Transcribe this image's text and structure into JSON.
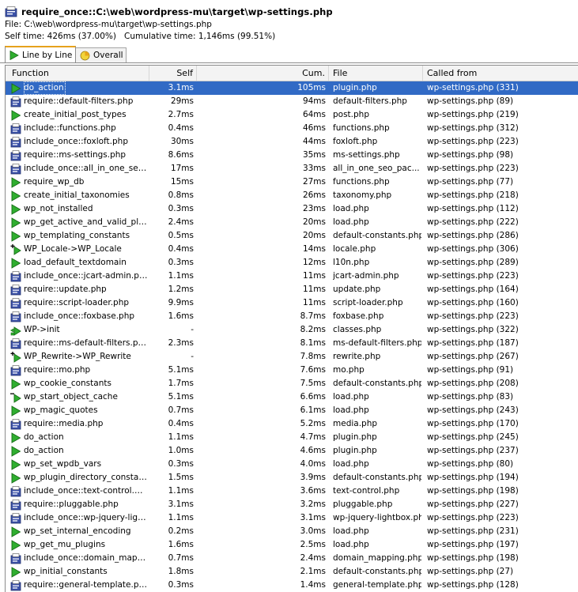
{
  "header": {
    "title": "require_once::C:\\web\\wordpress-mu\\target\\wp-settings.php",
    "file_line": "File: C:\\web\\wordpress-mu\\target\\wp-settings.php",
    "self_time": "Self time: 426ms (37.00%)",
    "cumulative_time": "Cumulative time: 1,146ms (99.51%)"
  },
  "tabs": [
    {
      "label": "Line by Line",
      "icon": "play-icon",
      "active": true
    },
    {
      "label": "Overall",
      "icon": "pie-chart-icon",
      "active": false
    }
  ],
  "columns": {
    "function": "Function",
    "self": "Self",
    "cum": "Cum.",
    "file": "File",
    "called_from": "Called from"
  },
  "rows": [
    {
      "icon": "play",
      "function": "do_action",
      "self": "3.1ms",
      "cum": "105ms",
      "file": "plugin.php",
      "called_from": "wp-settings.php (331)",
      "selected": true
    },
    {
      "icon": "php",
      "function": "require::default-filters.php",
      "self": "29ms",
      "cum": "94ms",
      "file": "default-filters.php",
      "called_from": "wp-settings.php (89)"
    },
    {
      "icon": "play",
      "function": "create_initial_post_types",
      "self": "2.7ms",
      "cum": "64ms",
      "file": "post.php",
      "called_from": "wp-settings.php (219)"
    },
    {
      "icon": "php",
      "function": "include::functions.php",
      "self": "0.4ms",
      "cum": "46ms",
      "file": "functions.php",
      "called_from": "wp-settings.php (312)"
    },
    {
      "icon": "php",
      "function": "include_once::foxloft.php",
      "self": "30ms",
      "cum": "44ms",
      "file": "foxloft.php",
      "called_from": "wp-settings.php (223)"
    },
    {
      "icon": "php",
      "function": "require::ms-settings.php",
      "self": "8.6ms",
      "cum": "35ms",
      "file": "ms-settings.php",
      "called_from": "wp-settings.php (98)"
    },
    {
      "icon": "php",
      "function": "include_once::all_in_one_seo_...",
      "self": "17ms",
      "cum": "33ms",
      "file": "all_in_one_seo_pac...",
      "called_from": "wp-settings.php (223)"
    },
    {
      "icon": "play",
      "function": "require_wp_db",
      "self": "15ms",
      "cum": "27ms",
      "file": "functions.php",
      "called_from": "wp-settings.php (77)"
    },
    {
      "icon": "play",
      "function": "create_initial_taxonomies",
      "self": "0.8ms",
      "cum": "26ms",
      "file": "taxonomy.php",
      "called_from": "wp-settings.php (218)"
    },
    {
      "icon": "play",
      "function": "wp_not_installed",
      "self": "0.3ms",
      "cum": "23ms",
      "file": "load.php",
      "called_from": "wp-settings.php (112)"
    },
    {
      "icon": "play",
      "function": "wp_get_active_and_valid_plu...",
      "self": "2.4ms",
      "cum": "20ms",
      "file": "load.php",
      "called_from": "wp-settings.php (222)"
    },
    {
      "icon": "play",
      "function": "wp_templating_constants",
      "self": "0.5ms",
      "cum": "20ms",
      "file": "default-constants.php",
      "called_from": "wp-settings.php (286)"
    },
    {
      "icon": "new",
      "function": "WP_Locale->WP_Locale",
      "self": "0.4ms",
      "cum": "14ms",
      "file": "locale.php",
      "called_from": "wp-settings.php (306)"
    },
    {
      "icon": "play",
      "function": "load_default_textdomain",
      "self": "0.3ms",
      "cum": "12ms",
      "file": "l10n.php",
      "called_from": "wp-settings.php (289)"
    },
    {
      "icon": "php",
      "function": "include_once::jcart-admin.php",
      "self": "1.1ms",
      "cum": "11ms",
      "file": "jcart-admin.php",
      "called_from": "wp-settings.php (223)"
    },
    {
      "icon": "php",
      "function": "require::update.php",
      "self": "1.2ms",
      "cum": "11ms",
      "file": "update.php",
      "called_from": "wp-settings.php (164)"
    },
    {
      "icon": "php",
      "function": "require::script-loader.php",
      "self": "9.9ms",
      "cum": "11ms",
      "file": "script-loader.php",
      "called_from": "wp-settings.php (160)"
    },
    {
      "icon": "php",
      "function": "include_once::foxbase.php",
      "self": "1.6ms",
      "cum": "8.7ms",
      "file": "foxbase.php",
      "called_from": "wp-settings.php (223)"
    },
    {
      "icon": "method",
      "function": "WP->init",
      "self": "-",
      "cum": "8.2ms",
      "file": "classes.php",
      "called_from": "wp-settings.php (322)"
    },
    {
      "icon": "php",
      "function": "require::ms-default-filters.php",
      "self": "2.3ms",
      "cum": "8.1ms",
      "file": "ms-default-filters.php",
      "called_from": "wp-settings.php (187)"
    },
    {
      "icon": "new",
      "function": "WP_Rewrite->WP_Rewrite",
      "self": "-",
      "cum": "7.8ms",
      "file": "rewrite.php",
      "called_from": "wp-settings.php (267)"
    },
    {
      "icon": "php",
      "function": "require::mo.php",
      "self": "5.1ms",
      "cum": "7.6ms",
      "file": "mo.php",
      "called_from": "wp-settings.php (91)"
    },
    {
      "icon": "play",
      "function": "wp_cookie_constants",
      "self": "1.7ms",
      "cum": "7.5ms",
      "file": "default-constants.php",
      "called_from": "wp-settings.php (208)"
    },
    {
      "icon": "minus",
      "function": "wp_start_object_cache",
      "self": "5.1ms",
      "cum": "6.6ms",
      "file": "load.php",
      "called_from": "wp-settings.php (83)"
    },
    {
      "icon": "play",
      "function": "wp_magic_quotes",
      "self": "0.7ms",
      "cum": "6.1ms",
      "file": "load.php",
      "called_from": "wp-settings.php (243)"
    },
    {
      "icon": "php",
      "function": "require::media.php",
      "self": "0.4ms",
      "cum": "5.2ms",
      "file": "media.php",
      "called_from": "wp-settings.php (170)"
    },
    {
      "icon": "play",
      "function": "do_action",
      "self": "1.1ms",
      "cum": "4.7ms",
      "file": "plugin.php",
      "called_from": "wp-settings.php (245)"
    },
    {
      "icon": "play",
      "function": "do_action",
      "self": "1.0ms",
      "cum": "4.6ms",
      "file": "plugin.php",
      "called_from": "wp-settings.php (237)"
    },
    {
      "icon": "play",
      "function": "wp_set_wpdb_vars",
      "self": "0.3ms",
      "cum": "4.0ms",
      "file": "load.php",
      "called_from": "wp-settings.php (80)"
    },
    {
      "icon": "play",
      "function": "wp_plugin_directory_constants",
      "self": "1.5ms",
      "cum": "3.9ms",
      "file": "default-constants.php",
      "called_from": "wp-settings.php (194)"
    },
    {
      "icon": "php",
      "function": "include_once::text-control.php",
      "self": "1.1ms",
      "cum": "3.6ms",
      "file": "text-control.php",
      "called_from": "wp-settings.php (198)"
    },
    {
      "icon": "php",
      "function": "require::pluggable.php",
      "self": "3.1ms",
      "cum": "3.2ms",
      "file": "pluggable.php",
      "called_from": "wp-settings.php (227)"
    },
    {
      "icon": "php",
      "function": "include_once::wp-jquery-lightb...",
      "self": "1.1ms",
      "cum": "3.1ms",
      "file": "wp-jquery-lightbox.php",
      "called_from": "wp-settings.php (223)"
    },
    {
      "icon": "play",
      "function": "wp_set_internal_encoding",
      "self": "0.2ms",
      "cum": "3.0ms",
      "file": "load.php",
      "called_from": "wp-settings.php (231)"
    },
    {
      "icon": "play",
      "function": "wp_get_mu_plugins",
      "self": "1.6ms",
      "cum": "2.5ms",
      "file": "load.php",
      "called_from": "wp-settings.php (197)"
    },
    {
      "icon": "php",
      "function": "include_once::domain_mappin...",
      "self": "0.7ms",
      "cum": "2.4ms",
      "file": "domain_mapping.php",
      "called_from": "wp-settings.php (198)"
    },
    {
      "icon": "play",
      "function": "wp_initial_constants",
      "self": "1.8ms",
      "cum": "2.1ms",
      "file": "default-constants.php",
      "called_from": "wp-settings.php (27)"
    },
    {
      "icon": "php",
      "function": "require::general-template.php",
      "self": "0.3ms",
      "cum": "1.4ms",
      "file": "general-template.php",
      "called_from": "wp-settings.php (128)"
    }
  ]
}
